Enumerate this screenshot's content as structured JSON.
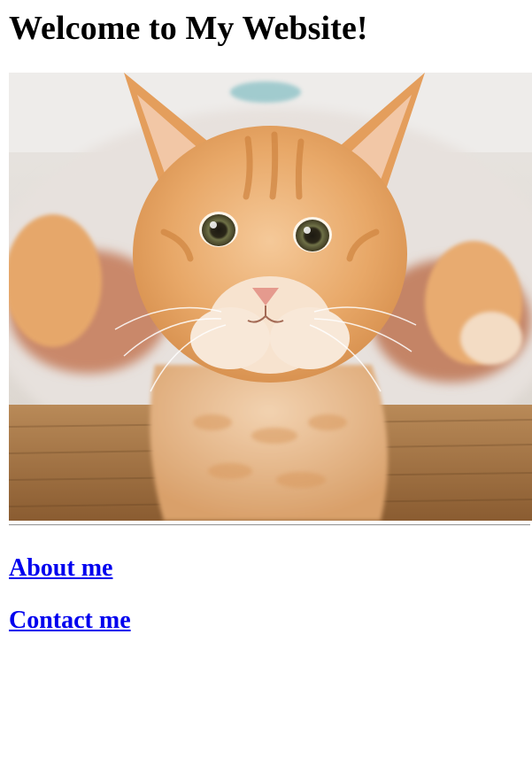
{
  "page": {
    "title": "Welcome to My Website!"
  },
  "hero_image": {
    "subject": "orange-tabby-kitten-photo"
  },
  "nav_links": [
    {
      "label": "About me"
    },
    {
      "label": "Contact me"
    }
  ],
  "colors": {
    "link": "#0000ee",
    "text": "#000000",
    "background": "#ffffff"
  }
}
